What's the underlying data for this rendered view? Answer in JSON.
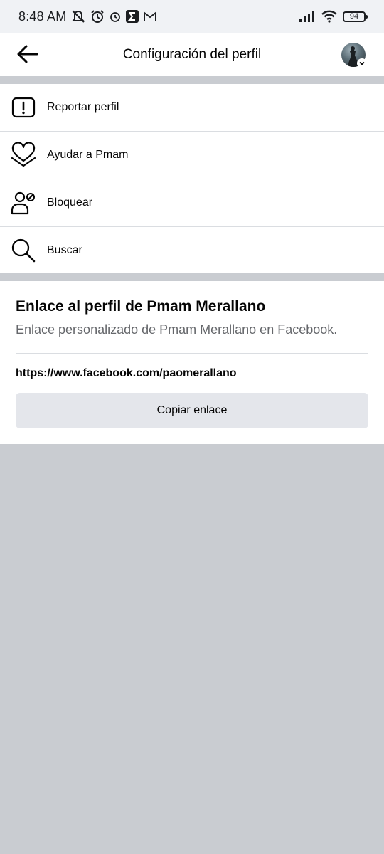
{
  "status_bar": {
    "time": "8:48 AM",
    "battery": "94",
    "left_icons": [
      "mute-icon",
      "alarm-icon",
      "alarm-small-icon",
      "sigma-app-icon",
      "gmail-icon"
    ],
    "right_icons": [
      "signal-icon",
      "wifi-icon",
      "battery-icon"
    ]
  },
  "header": {
    "title": "Configuración del perfil",
    "back_icon": "arrow-left-icon",
    "avatar_icon": "profile-avatar"
  },
  "menu": {
    "items": [
      {
        "label": "Reportar perfil",
        "icon": "report-icon"
      },
      {
        "label": "Ayudar a Pmam",
        "icon": "heart-hands-icon"
      },
      {
        "label": "Bloquear",
        "icon": "block-user-icon"
      },
      {
        "label": "Buscar",
        "icon": "search-icon"
      }
    ]
  },
  "profile_link": {
    "title": "Enlace al perfil de Pmam Merallano",
    "subtitle": "Enlace personalizado de Pmam Merallano en Facebook.",
    "url": "https://www.facebook.com/paomerallano",
    "copy_button": "Copiar enlace"
  },
  "colors": {
    "background_gray": "#c9ccd1",
    "button_gray": "#e4e6eb",
    "secondary_text": "#65676b",
    "divider": "#dadde1"
  }
}
